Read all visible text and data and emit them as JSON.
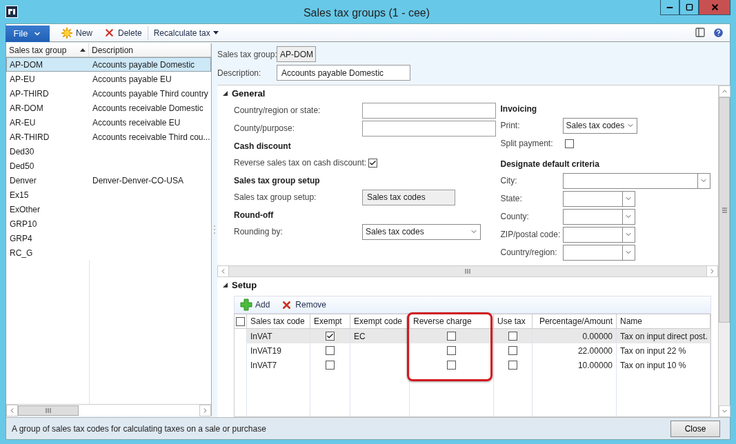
{
  "window": {
    "title": "Sales tax groups (1 - cee)"
  },
  "toolbar": {
    "file_button": "File",
    "actions": [
      {
        "label": "New",
        "kind": "new"
      },
      {
        "label": "Delete",
        "kind": "delete"
      },
      {
        "label": "Recalculate tax",
        "kind": "menu"
      }
    ]
  },
  "list": {
    "columns": [
      {
        "label": "Sales tax group",
        "sorted": true
      },
      {
        "label": "Description",
        "sorted": false
      }
    ],
    "rows": [
      {
        "group": "AP-DOM",
        "description": "Accounts payable Domestic",
        "selected": true
      },
      {
        "group": "AP-EU",
        "description": "Accounts payable EU",
        "selected": false
      },
      {
        "group": "AP-THIRD",
        "description": "Accounts payable Third country",
        "selected": false
      },
      {
        "group": "AR-DOM",
        "description": "Accounts receivable Domestic",
        "selected": false
      },
      {
        "group": "AR-EU",
        "description": "Accounts receivable EU",
        "selected": false
      },
      {
        "group": "AR-THIRD",
        "description": "Accounts receivable Third cou...",
        "selected": false
      },
      {
        "group": "Ded30",
        "selected": false
      },
      {
        "group": "Ded50",
        "selected": false
      },
      {
        "group": "Denver",
        "description": "Denver-Denver-CO-USA",
        "selected": false
      },
      {
        "group": "Ex15",
        "selected": false
      },
      {
        "group": "ExOther",
        "selected": false
      },
      {
        "group": "GRP10",
        "selected": false
      },
      {
        "group": "GRP4",
        "selected": false
      },
      {
        "group": "RC_G",
        "selected": false
      }
    ]
  },
  "header": [
    {
      "label": "Sales tax group:",
      "value": "AP-DOM",
      "kind": "readonly"
    },
    {
      "label": "Description:",
      "value": "Accounts payable Domestic",
      "kind": "text"
    }
  ],
  "general": {
    "title": "General",
    "expanded": true,
    "left": [
      {
        "kind": "text",
        "label": "Country/region or state:"
      },
      {
        "kind": "text",
        "label": "County/purpose:"
      },
      {
        "kind": "heading",
        "label": "Cash discount"
      },
      {
        "kind": "checkbox",
        "label": "Reverse sales tax on cash discount:",
        "checked": true
      },
      {
        "kind": "heading",
        "label": "Sales tax group setup"
      },
      {
        "kind": "readonly",
        "label": "Sales tax group setup:",
        "value": "Sales tax codes"
      },
      {
        "kind": "heading",
        "label": "Round-off"
      },
      {
        "kind": "combo",
        "label": "Rounding by:",
        "value": "Sales tax codes"
      }
    ],
    "right": [
      {
        "kind": "heading",
        "label": "Invoicing"
      },
      {
        "kind": "combo",
        "label": "Print:",
        "value": "Sales tax codes"
      },
      {
        "kind": "checkbox",
        "label": "Split payment:",
        "checked": false
      },
      {
        "kind": "heading",
        "label": "Designate default criteria"
      },
      {
        "kind": "wide",
        "label": "City:"
      },
      {
        "kind": "lookup",
        "label": "State:"
      },
      {
        "kind": "lookup",
        "label": "County:"
      },
      {
        "kind": "lookup",
        "label": "ZIP/postal code:"
      },
      {
        "kind": "lookup",
        "label": "Country/region:"
      }
    ]
  },
  "setup": {
    "title": "Setup",
    "expanded": true,
    "select_all": false,
    "actions": [
      {
        "label": "Add",
        "kind": "add"
      },
      {
        "label": "Remove",
        "kind": "remove"
      }
    ],
    "columns": [
      {
        "label": "Sales tax code",
        "highlighted": false
      },
      {
        "label": "Exempt",
        "highlighted": false
      },
      {
        "label": "Exempt code",
        "highlighted": false
      },
      {
        "label": "Reverse charge",
        "highlighted": true
      },
      {
        "label": "Use tax",
        "highlighted": false
      },
      {
        "label": "Percentage/Amount",
        "highlighted": false
      },
      {
        "label": "Name",
        "highlighted": false
      }
    ],
    "rows": [
      {
        "code": "InVAT",
        "exempt": true,
        "exempt_code": "EC",
        "reverse_charge": false,
        "use_tax": false,
        "amount": "0.00000",
        "name": "Tax on input direct post.",
        "selected": true
      },
      {
        "code": "InVAT19",
        "exempt": false,
        "reverse_charge": false,
        "use_tax": false,
        "amount": "22.00000",
        "name": "Tax on input 22 %",
        "selected": false
      },
      {
        "code": "InVAT7",
        "exempt": false,
        "reverse_charge": false,
        "use_tax": false,
        "amount": "10.00000",
        "name": "Tax on input 10 %",
        "selected": false
      }
    ]
  },
  "status_bar": {
    "text": "A group of sales tax codes for calculating taxes on a sale or purchase",
    "close_button": "Close"
  }
}
